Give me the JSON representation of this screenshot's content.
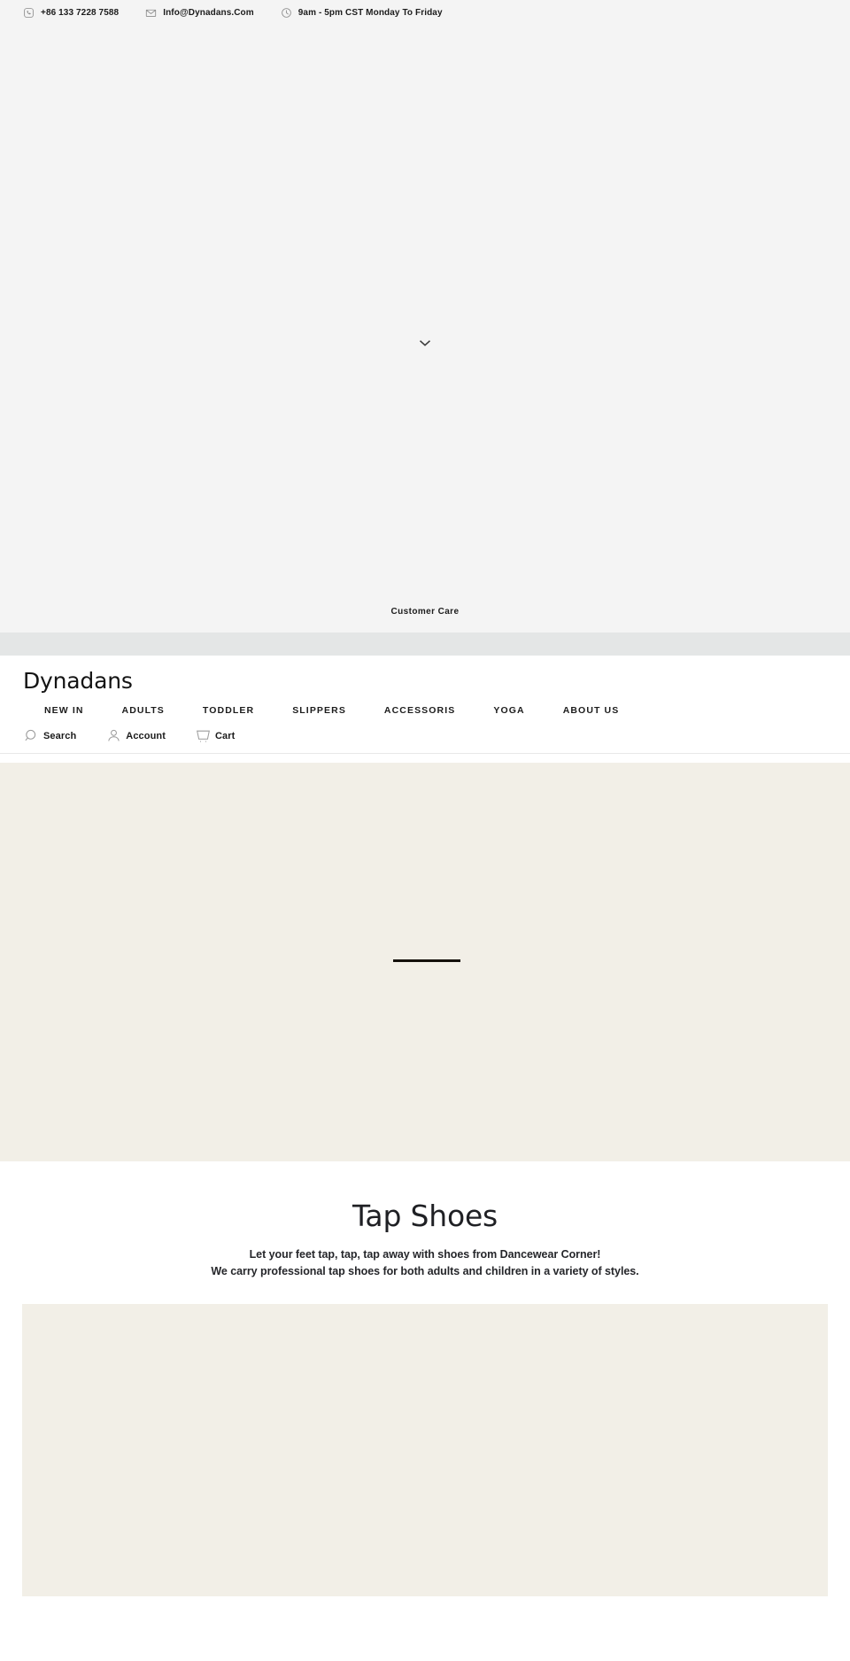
{
  "topbar": {
    "items": [
      {
        "icon": "phone-icon",
        "label": "+86 133 7228 7588"
      },
      {
        "icon": "envelope-icon",
        "label": "Info@Dynadans.Com"
      },
      {
        "icon": "clock-icon",
        "label": "9am - 5pm CST Monday To Friday"
      }
    ]
  },
  "hero": {
    "scroll_cue_icon": "chevron-down-icon",
    "bottom_link": "Customer Care",
    "background_color": "#f4f4f4"
  },
  "divider": {
    "color": "#e4e6e6"
  },
  "header": {
    "logo": "Dynadans",
    "nav": [
      {
        "label": "NEW IN"
      },
      {
        "label": "ADULTS"
      },
      {
        "label": "TODDLER"
      },
      {
        "label": "SLIPPERS"
      },
      {
        "label": "ACCESSORIS"
      },
      {
        "label": "YOGA"
      },
      {
        "label": "ABOUT US"
      }
    ],
    "utilities": [
      {
        "icon": "search-icon",
        "label": "Search"
      },
      {
        "icon": "account-icon",
        "label": "Account"
      },
      {
        "icon": "cart-icon",
        "label": "Cart"
      }
    ]
  },
  "banner": {
    "background_color": "#f2efe7",
    "rule_color": "#15110c"
  },
  "collection": {
    "title": "Tap Shoes",
    "description_line1": "Let your feet tap, tap, tap away with shoes from Dancewear Corner!",
    "description_line2": "We carry professional tap shoes for both adults and children in a variety of styles."
  },
  "product_grid": {
    "panel_color": "#f2efe7"
  }
}
